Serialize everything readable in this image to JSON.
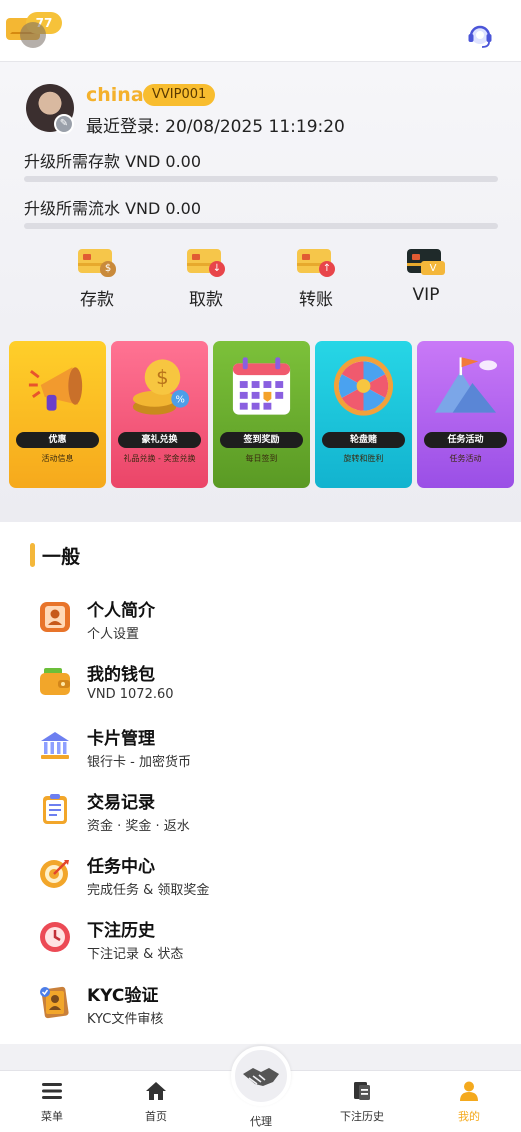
{
  "header": {
    "message_count": "77",
    "icons": [
      "mail-icon",
      "headset-support-icon"
    ]
  },
  "profile": {
    "username": "china",
    "vip_level": "VVIP001",
    "last_login": "最近登录: 20/08/2025 11:19:20",
    "deposit_requirement": "升级所需存款 VND 0.00",
    "deposit_progress": 0,
    "turnover_requirement": "升级所需流水 VND 0.00",
    "turnover_progress": 0
  },
  "quick_actions": [
    {
      "label": "存款",
      "icon": "deposit-card-icon"
    },
    {
      "label": "取款",
      "icon": "withdraw-card-icon"
    },
    {
      "label": "转账",
      "icon": "transfer-card-icon"
    },
    {
      "label": "VIP",
      "icon": "vip-card-icon"
    }
  ],
  "promos": [
    {
      "title": "优惠",
      "subtitle": "活动信息",
      "color": "#f9c421"
    },
    {
      "title": "豪礼兑换",
      "subtitle": "礼品兑换 - 奖金兑换",
      "color": "#f0567a"
    },
    {
      "title": "签到奖励",
      "subtitle": "每日签到",
      "color": "#6caa2c"
    },
    {
      "title": "轮盘赌",
      "subtitle": "旋转和胜利",
      "color": "#1cc8dc"
    },
    {
      "title": "任务活动",
      "subtitle": "任务活动",
      "color": "#b15ef0"
    }
  ],
  "general": {
    "title": "一般",
    "items": [
      {
        "title": "个人简介",
        "subtitle": "个人设置",
        "icon": "profile-card-icon"
      },
      {
        "title": "我的钱包",
        "subtitle": "VND 1072.60",
        "icon": "wallet-icon"
      },
      {
        "title": "卡片管理",
        "subtitle": "银行卡 - 加密货币",
        "icon": "bank-icon"
      },
      {
        "title": "交易记录",
        "subtitle": "资金 · 奖金 · 返水",
        "icon": "clipboard-icon"
      },
      {
        "title": "任务中心",
        "subtitle": "完成任务 & 领取奖金",
        "icon": "target-icon"
      },
      {
        "title": "下注历史",
        "subtitle": "下注记录 & 状态",
        "icon": "history-clock-icon"
      },
      {
        "title": "KYC验证",
        "subtitle": "KYC文件审核",
        "icon": "id-document-icon"
      }
    ]
  },
  "bottom_nav": [
    {
      "label": "菜单",
      "icon": "menu-icon"
    },
    {
      "label": "首页",
      "icon": "home-icon"
    },
    {
      "label": "代理",
      "icon": "handshake-icon"
    },
    {
      "label": "下注历史",
      "icon": "bet-history-icon"
    },
    {
      "label": "我的",
      "icon": "user-icon",
      "active": true
    }
  ],
  "colors": {
    "accent": "#f4b12c",
    "active_nav": "#f4a91d"
  }
}
